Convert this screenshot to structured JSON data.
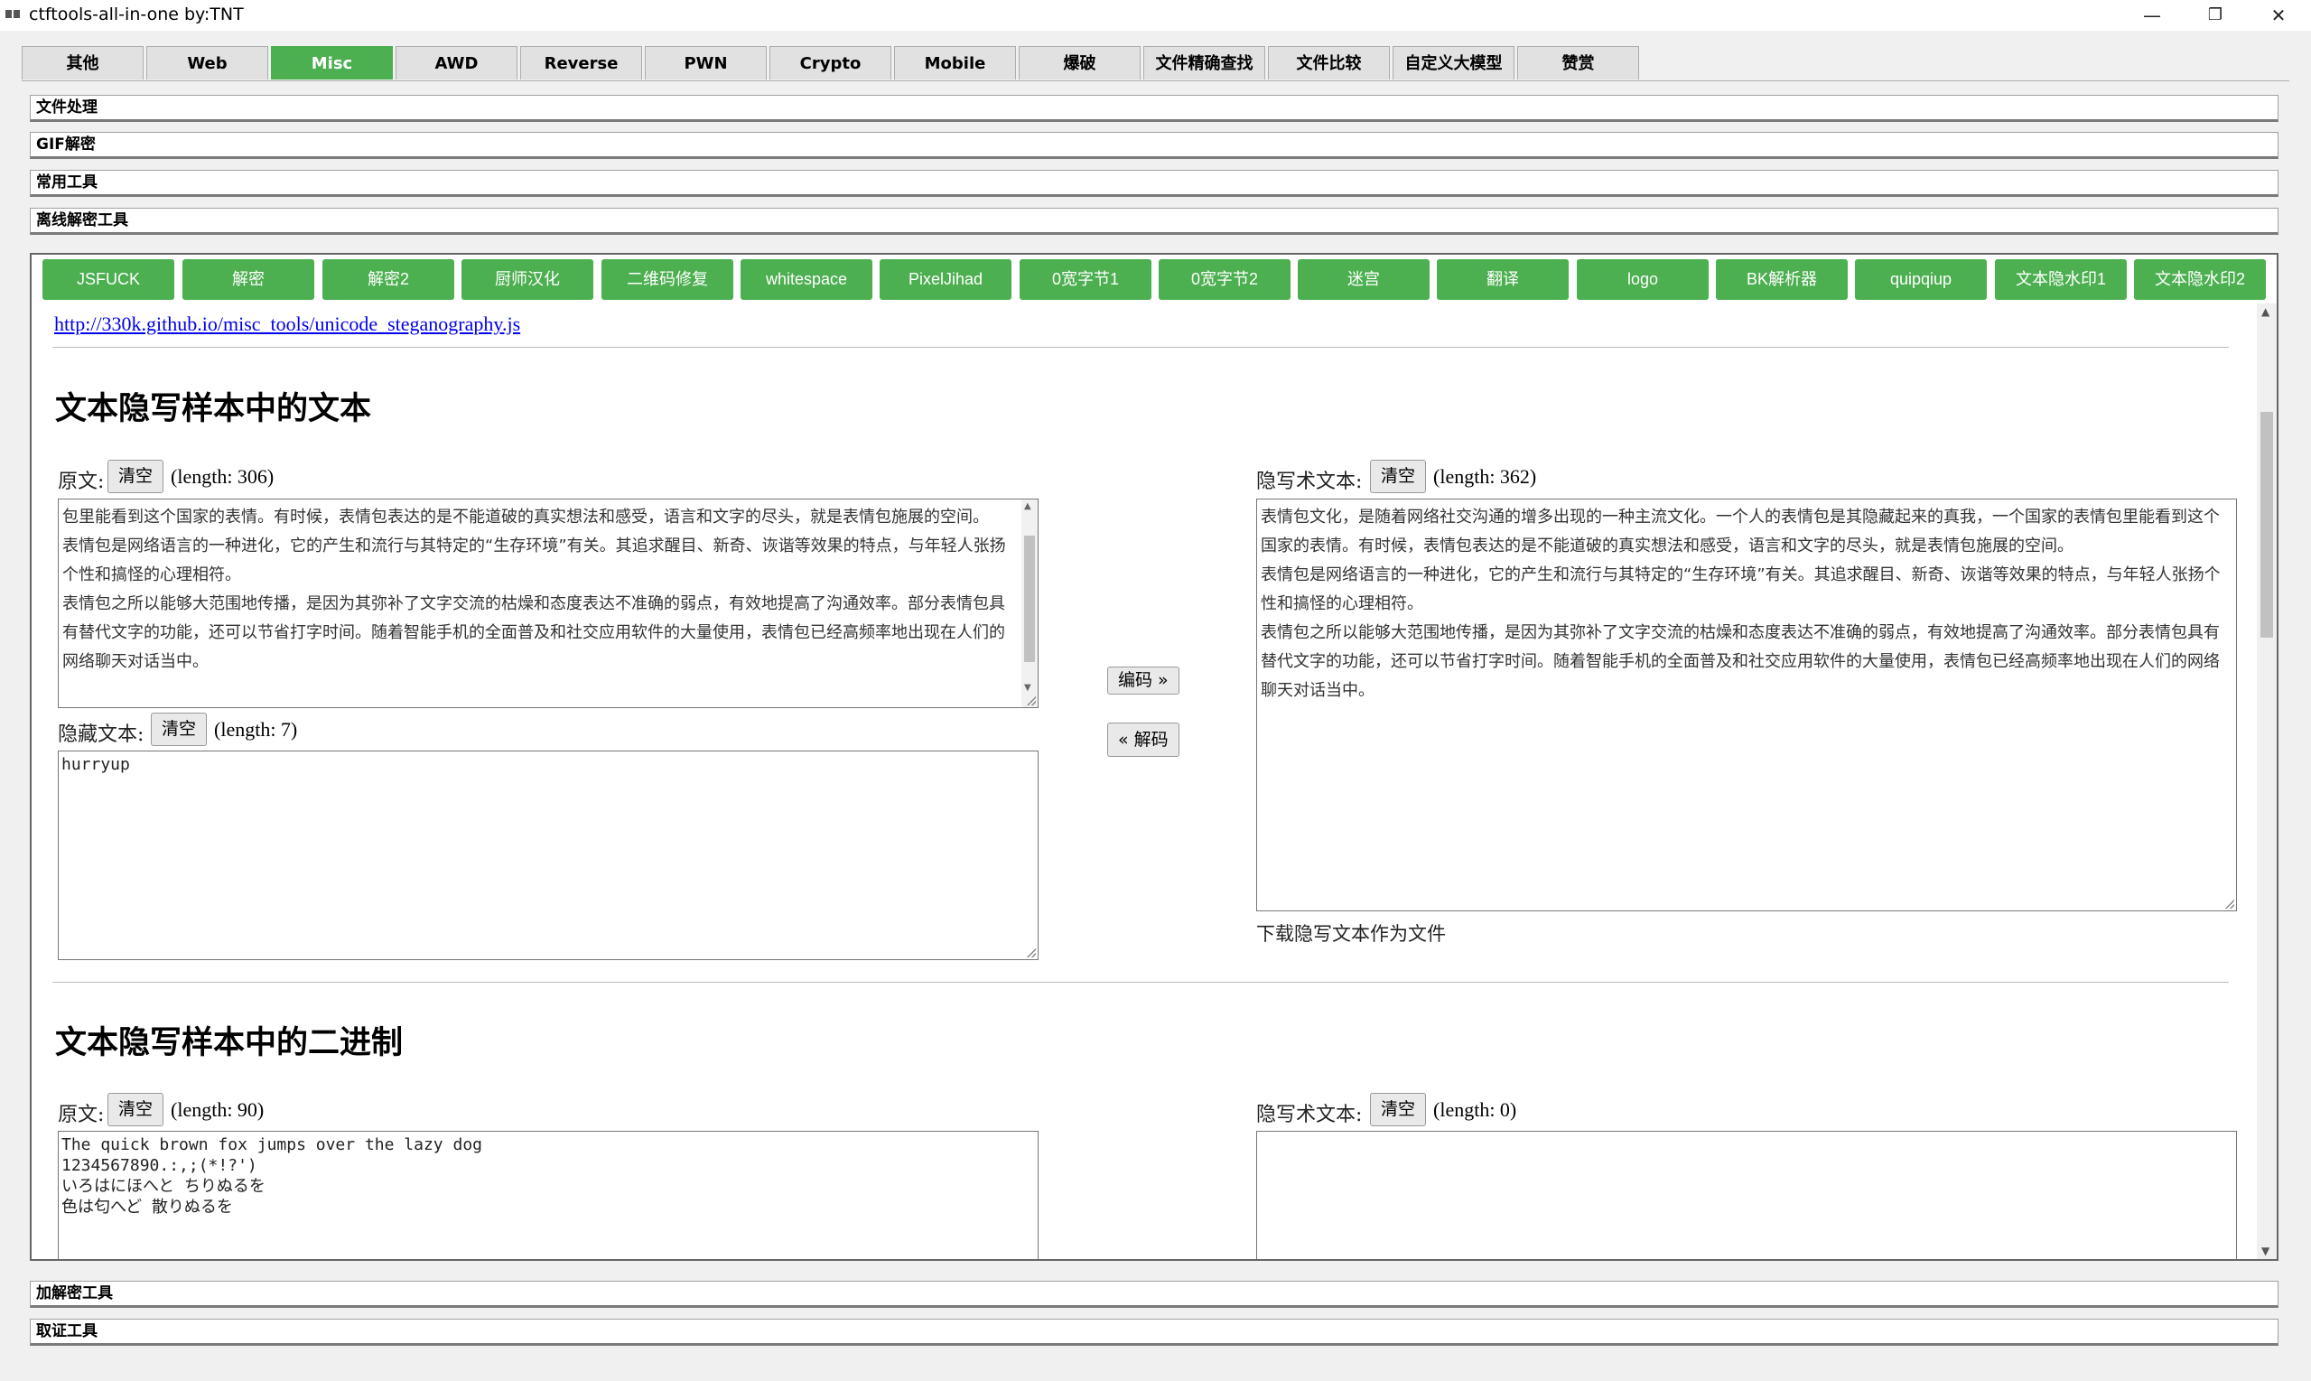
{
  "window": {
    "title": "ctftools-all-in-one   by:TNT",
    "minimize": "—",
    "maximize": "❐",
    "close": "✕"
  },
  "tabs": [
    "其他",
    "Web",
    "Misc",
    "AWD",
    "Reverse",
    "PWN",
    "Crypto",
    "Mobile",
    "爆破",
    "文件精确查找",
    "文件比较",
    "自定义大模型",
    "赞赏"
  ],
  "active_tab": "Misc",
  "accordion": {
    "file": "文件处理",
    "gif": "GIF解密",
    "common": "常用工具",
    "offline": "离线解密工具",
    "encdec": "加解密工具",
    "forensics": "取证工具"
  },
  "tool_buttons": [
    "JSFUCK",
    "解密",
    "解密2",
    "厨师汉化",
    "二维码修复",
    "whitespace",
    "PixelJihad",
    "0宽字节1",
    "0宽字节2",
    "迷宫",
    "翻译",
    "logo",
    "BK解析器",
    "quipqiup",
    "文本隐水印1",
    "文本隐水印2"
  ],
  "content": {
    "link": "http://330k.github.io/misc_tools/unicode_steganography.js",
    "section1": {
      "title": "文本隐写样本中的文本",
      "original_label": "原文:",
      "clear": "清空",
      "original_length": "(length: 306)",
      "original_text": "包里能看到这个国家的表情。有时候，表情包表达的是不能道破的真实想法和感受，语言和文字的尽头，就是表情包施展的空间。\n表情包是网络语言的一种进化，它的产生和流行与其特定的“生存环境”有关。其追求醒目、新奇、诙谐等效果的特点，与年轻人张扬个性和搞怪的心理相符。\n表情包之所以能够大范围地传播，是因为其弥补了文字交流的枯燥和态度表达不准确的弱点，有效地提高了沟通效率。部分表情包具有替代文字的功能，还可以节省打字时间。随着智能手机的全面普及和社交应用软件的大量使用，表情包已经高频率地出现在人们的网络聊天对话当中。",
      "hidden_label": "隐藏文本:",
      "hidden_length": "(length: 7)",
      "hidden_text": "hurryup",
      "encode": "编码 »",
      "decode": "« 解码",
      "stego_label": "隐写术文本:",
      "stego_length": "(length: 362)",
      "stego_text": "表情包文化，是随着网络社交沟通的增多出现的一种主流文化。一个人的表情包是其隐藏起来的真我，一个国家的表情包里能看到这个国家的表情。有时候，表情包表达的是不能道破的真实想法和感受，语言和文字的尽头，就是表情包施展的空间。\n表情包是网络语言的一种进化，它的产生和流行与其特定的“生存环境”有关。其追求醒目、新奇、诙谐等效果的特点，与年轻人张扬个性和搞怪的心理相符。\n表情包之所以能够大范围地传播，是因为其弥补了文字交流的枯燥和态度表达不准确的弱点，有效地提高了沟通效率。部分表情包具有替代文字的功能，还可以节省打字时间。随着智能手机的全面普及和社交应用软件的大量使用，表情包已经高频率地出现在人们的网络聊天对话当中。",
      "download": "下载隐写文本作为文件"
    },
    "section2": {
      "title": "文本隐写样本中的二进制",
      "original_label": "原文:",
      "clear": "清空",
      "original_length": "(length: 90)",
      "original_text": "The quick brown fox jumps over the lazy dog\n1234567890.:,;(*!?')\nいろはにほへと ちりぬるを\n色は匂へど 散りぬるを",
      "stego_label": "隐写术文本:",
      "stego_length": "(length: 0)",
      "stego_text": ""
    }
  }
}
